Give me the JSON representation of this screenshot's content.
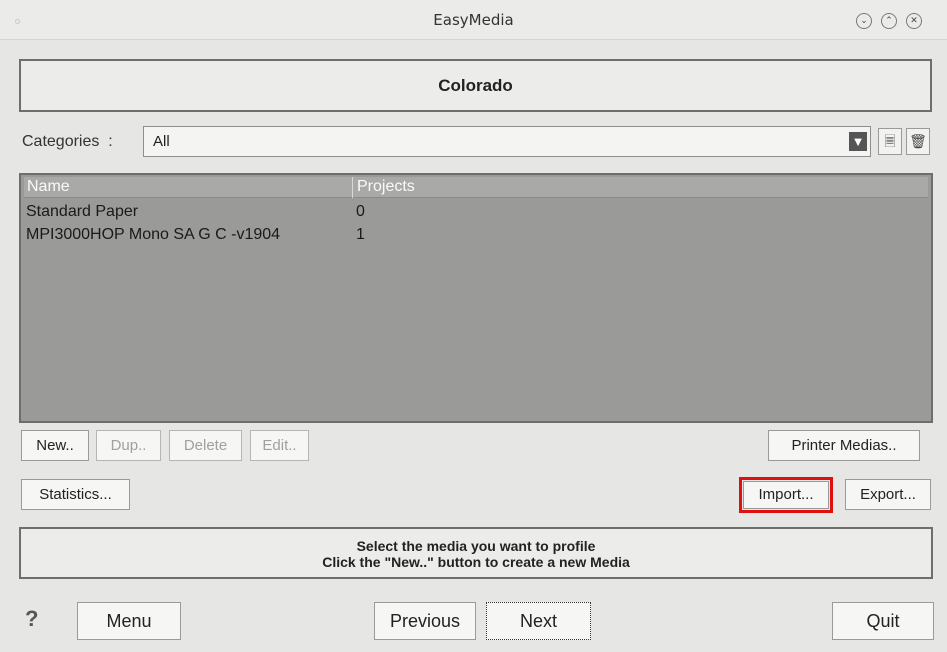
{
  "window": {
    "title": "EasyMedia"
  },
  "header": {
    "printer_name": "Colorado"
  },
  "categories": {
    "label": "Categories",
    "separator": ":",
    "selected": "All"
  },
  "list": {
    "columns": [
      "Name",
      "Projects"
    ],
    "rows": [
      {
        "name": "Standard Paper",
        "projects": "0"
      },
      {
        "name": "MPI3000HOP Mono SA G C -v1904",
        "projects": "1"
      }
    ]
  },
  "buttons": {
    "new": "New..",
    "dup": "Dup..",
    "delete": "Delete",
    "edit": "Edit..",
    "printer_medias": "Printer Medias..",
    "statistics": "Statistics...",
    "import": "Import...",
    "export": "Export..."
  },
  "info": {
    "line1": "Select the media you want to profile",
    "line2": "Click the \"New..\" button to create a new Media"
  },
  "footer": {
    "help": "?",
    "menu": "Menu",
    "previous": "Previous",
    "next": "Next",
    "quit": "Quit"
  },
  "icons": {
    "window_minimize": "chevron-down-icon",
    "window_maximize": "chevron-up-icon",
    "window_close": "close-icon",
    "filter": "filter-icon",
    "new_category": "new-document-icon",
    "delete_category": "trash-icon"
  },
  "colors": {
    "highlight": "#e01010"
  }
}
